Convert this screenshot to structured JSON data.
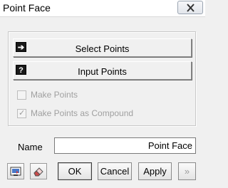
{
  "window": {
    "title": "Point Face"
  },
  "actions": {
    "select_points": {
      "label": "Select Points",
      "icon": "arrow-right-icon"
    },
    "input_points": {
      "label": "Input Points",
      "icon": "question-icon"
    }
  },
  "options": {
    "make_points": {
      "label": "Make Points",
      "checked": false,
      "enabled": false
    },
    "make_points_compound": {
      "label": "Make Points as Compound",
      "checked": true,
      "enabled": false
    }
  },
  "name": {
    "label": "Name",
    "value": "Point Face"
  },
  "footer": {
    "ok_label": "OK",
    "cancel_label": "Cancel",
    "apply_label": "Apply",
    "more_label": "»"
  },
  "colors": {
    "background": "#f0f0f0",
    "disabled_text": "#a0a0a0"
  }
}
